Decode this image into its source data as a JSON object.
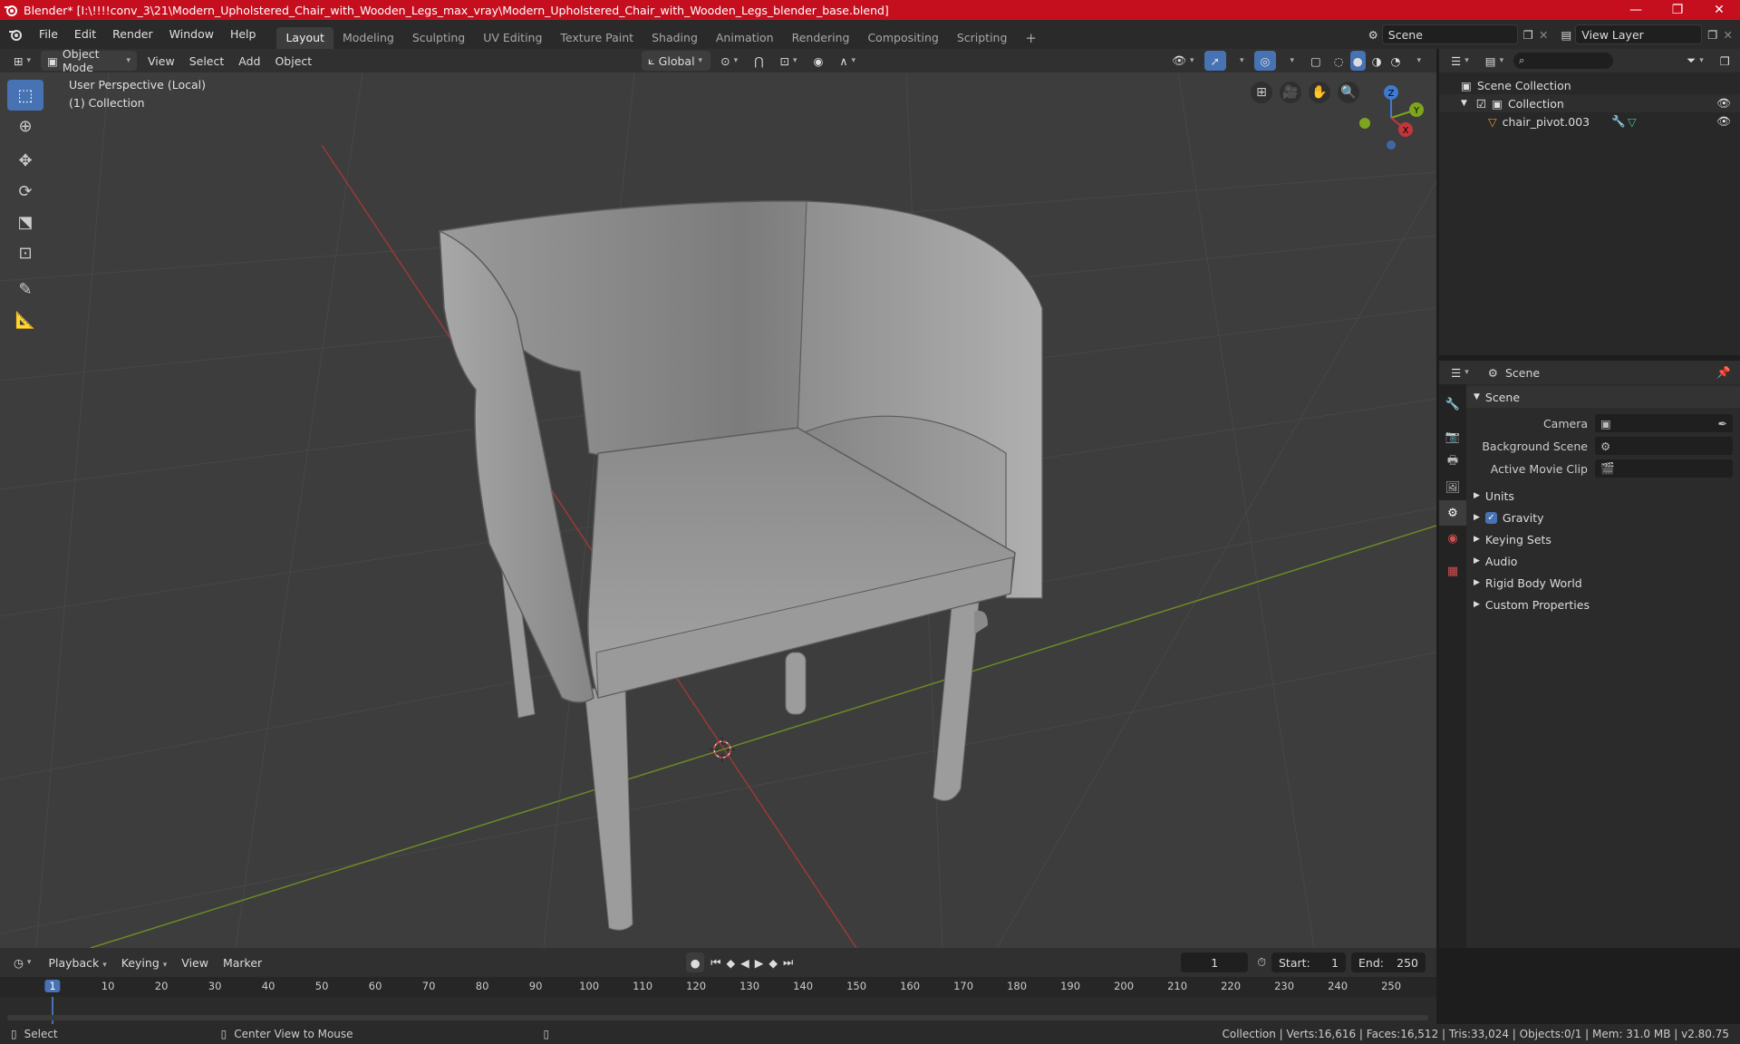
{
  "window": {
    "title": "Blender* [I:\\!!!!conv_3\\21\\Modern_Upholstered_Chair_with_Wooden_Legs_max_vray\\Modern_Upholstered_Chair_with_Wooden_Legs_blender_base.blend]",
    "minimize": "—",
    "maximize": "❐",
    "close": "✕"
  },
  "menu": {
    "items": [
      "File",
      "Edit",
      "Render",
      "Window",
      "Help"
    ]
  },
  "workspaces": {
    "tabs": [
      "Layout",
      "Modeling",
      "Sculpting",
      "UV Editing",
      "Texture Paint",
      "Shading",
      "Animation",
      "Rendering",
      "Compositing",
      "Scripting"
    ],
    "active": "Layout",
    "add": "+"
  },
  "scene_selector": {
    "value": "Scene"
  },
  "view_layer_selector": {
    "value": "View Layer"
  },
  "viewport_header": {
    "mode": "Object Mode",
    "menus": [
      "View",
      "Select",
      "Add",
      "Object"
    ],
    "orientation": "Global"
  },
  "viewport": {
    "perspective_label": "User Perspective (Local)",
    "collection_label": "(1) Collection",
    "gizmo": {
      "z": "Z",
      "y": "Y",
      "x": "X"
    }
  },
  "outliner": {
    "search_placeholder": "",
    "root": "Scene Collection",
    "collection": "Collection",
    "object": "chair_pivot.003"
  },
  "properties": {
    "context": "Scene",
    "panel_title": "Scene",
    "fields": [
      {
        "label": "Camera",
        "value": ""
      },
      {
        "label": "Background Scene",
        "value": ""
      },
      {
        "label": "Active Movie Clip",
        "value": ""
      }
    ],
    "subpanels": [
      "Units",
      "Gravity",
      "Keying Sets",
      "Audio",
      "Rigid Body World",
      "Custom Properties"
    ],
    "gravity_checked": true
  },
  "timeline": {
    "menus": [
      "Playback",
      "Keying",
      "View",
      "Marker"
    ],
    "current_frame": "1",
    "start_label": "Start:",
    "start": "1",
    "end_label": "End:",
    "end": "250",
    "ruler": [
      "1",
      "10",
      "20",
      "30",
      "40",
      "50",
      "60",
      "70",
      "80",
      "90",
      "100",
      "110",
      "120",
      "130",
      "140",
      "150",
      "160",
      "170",
      "180",
      "190",
      "200",
      "210",
      "220",
      "230",
      "240",
      "250"
    ]
  },
  "status_bar": {
    "left_action": "Select",
    "middle_action": "Center View to Mouse",
    "stats": "Collection | Verts:16,616 | Faces:16,512 | Tris:33,024 | Objects:0/1 | Mem: 31.0 MB | v2.80.75"
  },
  "colors": {
    "titlebar": "#c50f1f",
    "accent": "#4772b3",
    "x_axis": "#c4363c",
    "y_axis": "#7ea51e",
    "z_axis": "#3f7ad2"
  }
}
